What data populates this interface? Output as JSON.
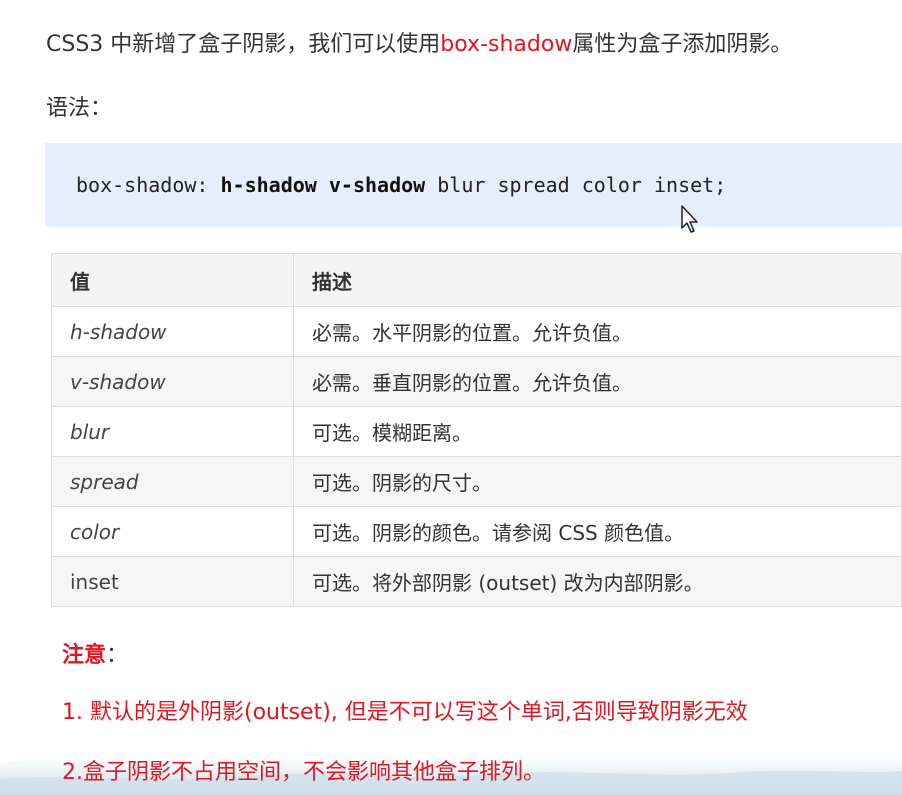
{
  "intro": {
    "before": "CSS3 中新增了盒子阴影，我们可以使用",
    "highlight": "box-shadow",
    "after": "属性为盒子添加阴影。"
  },
  "syntax_label": "语法：",
  "code": {
    "prefix": "box-shadow: ",
    "bold": "h-shadow v-shadow",
    "suffix": " blur spread color inset;"
  },
  "table": {
    "headers": [
      "值",
      "描述"
    ],
    "rows": [
      {
        "value": "h-shadow",
        "desc": "必需。水平阴影的位置。允许负值。"
      },
      {
        "value": "v-shadow",
        "desc": "必需。垂直阴影的位置。允许负值。"
      },
      {
        "value": "blur",
        "desc": "可选。模糊距离。"
      },
      {
        "value": "spread",
        "desc": "可选。阴影的尺寸。"
      },
      {
        "value": "color",
        "desc": "可选。阴影的颜色。请参阅 CSS 颜色值。"
      },
      {
        "value": "inset",
        "desc": "可选。将外部阴影 (outset) 改为内部阴影。"
      }
    ]
  },
  "note": {
    "title": "注意",
    "colon": "：",
    "items": [
      "1. 默认的是外阴影(outset), 但是不可以写这个单词,否则导致阴影无效",
      "2.盒子阴影不占用空间，不会影响其他盒子排列。"
    ]
  },
  "colors": {
    "highlight": "#e4151f",
    "code_bg": "#e5eefb",
    "table_border": "#dddddd"
  }
}
